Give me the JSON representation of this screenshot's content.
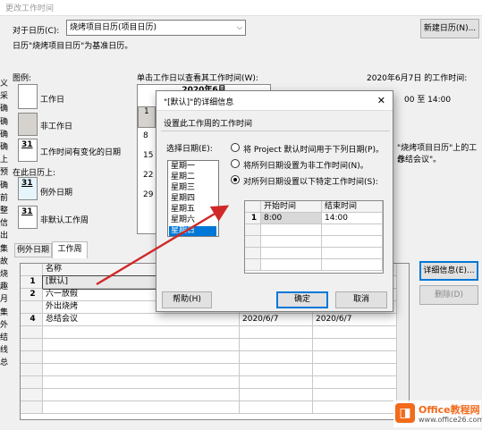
{
  "window": {
    "title": "更改工作时间"
  },
  "top": {
    "for_calendar_label": "对于日历(C):",
    "calendar_value": "烧烤项目日历(项目日历)",
    "new_calendar_button": "新建日历(N)...",
    "base_note": "日历\"烧烤项目日历\"为基准日历。"
  },
  "legend": {
    "title": "图例:",
    "working": "工作日",
    "nonworking": "非工作日",
    "changed": "工作时间有变化的日期",
    "on_this_calendar": "在此日历上:",
    "exception": "例外日期",
    "nondefault": "非默认工作周",
    "day_number": "31"
  },
  "calendar": {
    "instruction": "单击工作日以查看其工作时间(W):",
    "month": "2020年6月",
    "rows": [
      "1",
      "8",
      "15",
      "22",
      "29"
    ]
  },
  "right_info": {
    "date_title": "2020年6月7日 的工作时间:",
    "time_range": "00 至 14:00",
    "note1": "\"烧烤项目日历\"上的工作",
    "note2": "总结会议\"。"
  },
  "tabs": {
    "exceptions": "例外日期",
    "workweek": "工作周"
  },
  "table": {
    "name_header": "名称",
    "rows": [
      {
        "num": "1",
        "name": "[默认]",
        "start": "",
        "end": ""
      },
      {
        "num": "2",
        "name": "六一放假",
        "start": "",
        "end": ""
      },
      {
        "num": "",
        "name": "外出烧烤",
        "start": "",
        "end": ""
      },
      {
        "num": "4",
        "name": "总结会议",
        "start": "2020/6/7",
        "end": "2020/6/7"
      }
    ]
  },
  "right_buttons": {
    "details": "详细信息(E)...",
    "delete": "删除(D)"
  },
  "dialog": {
    "title": "\"[默认]\"的详细信息",
    "section": "设置此工作周的工作时间",
    "select_days_label": "选择日期(E):",
    "days": [
      "星期日",
      "星期一",
      "星期二",
      "星期三",
      "星期四",
      "星期五",
      "星期六"
    ],
    "selected_day": "星期日",
    "radio1": "将 Project 默认时间用于下列日期(P)。",
    "radio2": "将所列日期设置为非工作时间(N)。",
    "radio3": "对所列日期设置以下特定工作时间(S):",
    "grid_headers": {
      "start": "开始时间",
      "end": "结束时间"
    },
    "grid_rows": [
      {
        "num": "1",
        "start": "8:00",
        "end": "14:00"
      }
    ],
    "help": "帮助(H)",
    "ok": "确定",
    "cancel": "取消",
    "close": "✕"
  },
  "left_fragments": [
    "义",
    "采",
    "确",
    "确",
    "确",
    "确",
    "上",
    "预",
    "确",
    "前",
    "整",
    "信",
    "出",
    "集",
    "故",
    "烧",
    "趣",
    "月",
    "集",
    "外",
    "结",
    "线",
    "总"
  ],
  "watermark": {
    "brand": "Office教程网",
    "url": "www.office26.com"
  },
  "colors": {
    "accent": "#0078d7",
    "arrow": "#d02828",
    "nonworking_cell": "#d6d3ce",
    "exception_cell": "#e5f5fb",
    "logo": "#f26a1b"
  }
}
